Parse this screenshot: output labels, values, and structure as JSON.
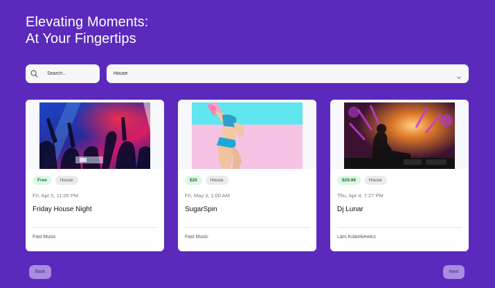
{
  "header": {
    "title_line1": "Elevating Moments:",
    "title_line2": "At Your Fingertips"
  },
  "search": {
    "placeholder": "Search..."
  },
  "filter": {
    "selected": "House",
    "icon": "chevron-down-icon"
  },
  "events": [
    {
      "price": "Free",
      "genre": "House",
      "date": "Fri, Apr 5, 11:00 PM",
      "name": "Friday House Night",
      "organizer": "Fast Music"
    },
    {
      "price": "$20",
      "genre": "House",
      "date": "Fri, May 3, 1:00 AM",
      "name": "SugarSpin",
      "organizer": "Fast Music"
    },
    {
      "price": "$29.99",
      "genre": "House",
      "date": "Thu, Apr 4, 7:27 PM",
      "name": "Dj Lunar",
      "organizer": "Lars Kolankiewicz"
    }
  ],
  "pagination": {
    "back_label": "Back",
    "next_label": "Next"
  },
  "colors": {
    "background": "#5b2abd",
    "price_tag_bg": "#dff7e6",
    "price_tag_text": "#1f6f3a",
    "pager_button": "#a98be0"
  }
}
